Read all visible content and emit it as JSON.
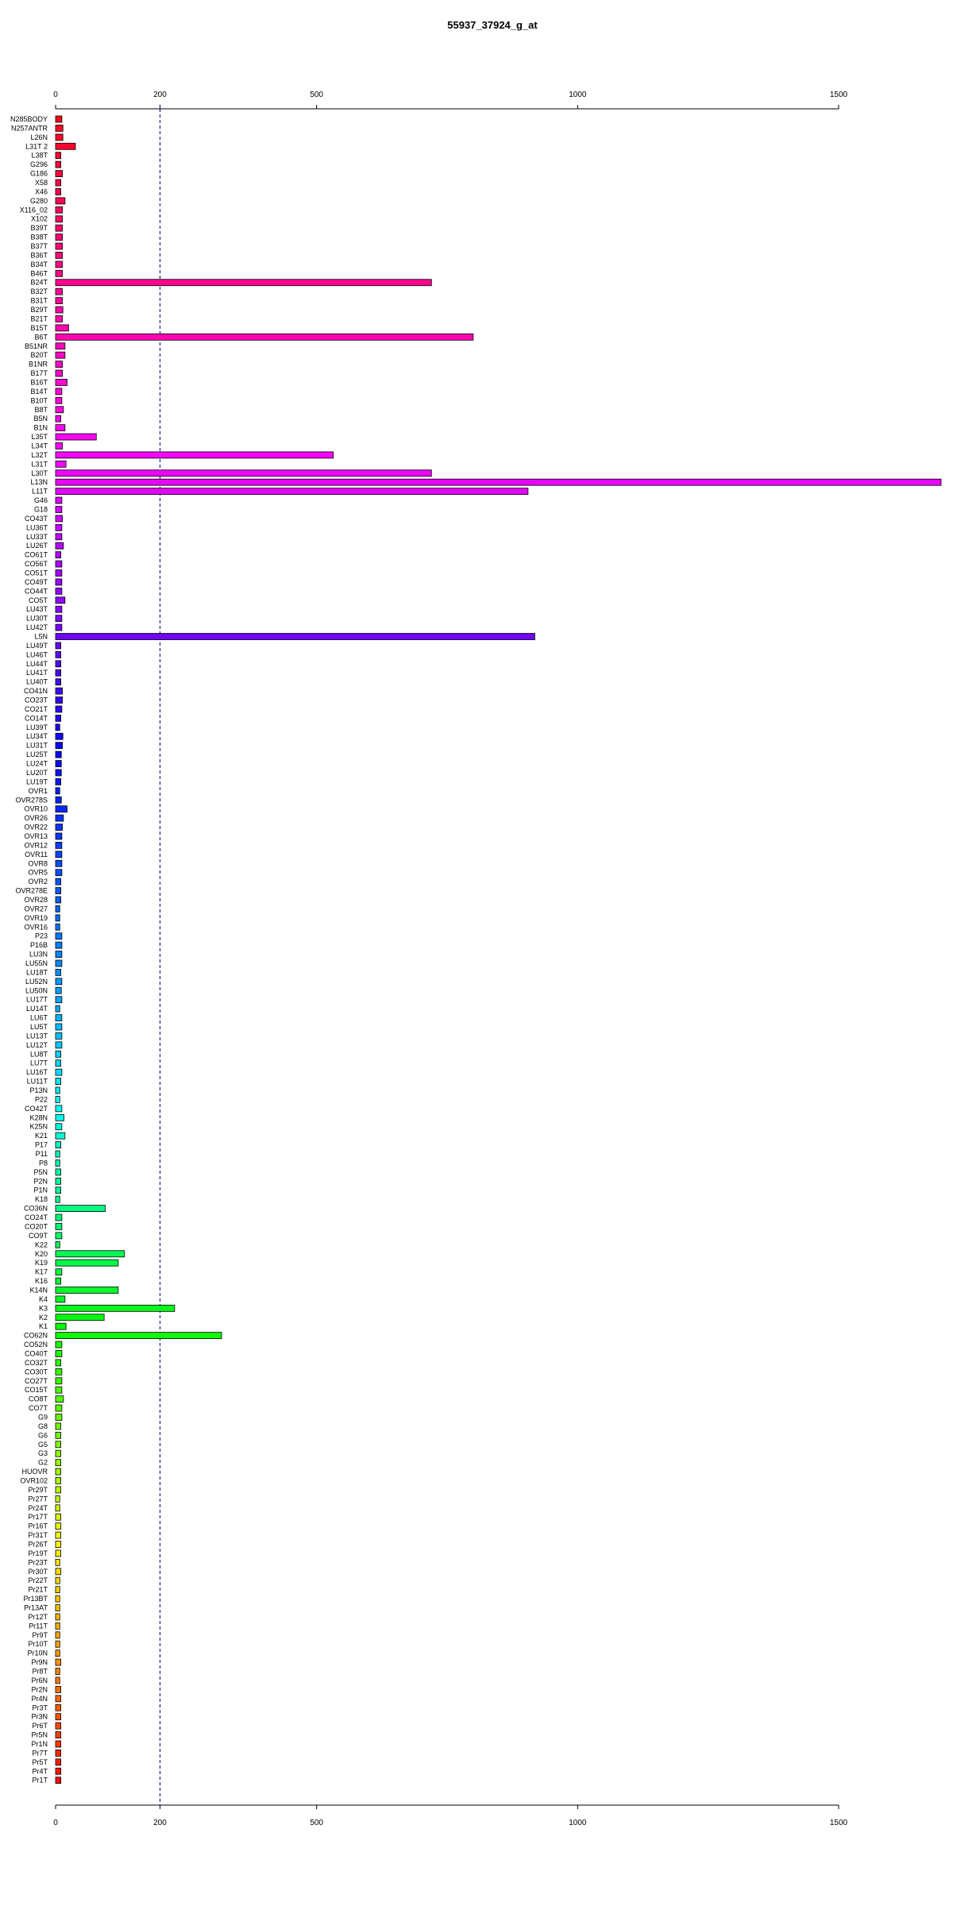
{
  "chart_data": {
    "type": "bar",
    "orientation": "horizontal",
    "title": "55937_37924_g_at",
    "xlabel": "",
    "ylabel": "",
    "xlim": [
      0,
      1500
    ],
    "xticks": [
      0,
      200,
      500,
      1000,
      1500
    ],
    "xtick_labels": [
      "0",
      "200",
      "500",
      "1000",
      "1500"
    ],
    "reference_line": 200,
    "axis_positions": [
      "top",
      "bottom"
    ],
    "bar_outline_color": "#000000",
    "bar_colors": "rainbow gradient from top to bottom: red, magenta, purple, blue, cyan, green, yellow, orange, red",
    "categories": [
      "N285BODY",
      "N257ANTR",
      "L26N",
      "L31T 2",
      "L38T",
      "G296",
      "G186",
      "X58",
      "X46",
      "G280",
      "X116_02",
      "X102",
      "B39T",
      "B38T",
      "B37T",
      "B36T",
      "B34T",
      "B46T",
      "B24T",
      "B32T",
      "B31T",
      "B29T",
      "B21T",
      "B15T",
      "B6T",
      "B51NR",
      "B20T",
      "B1NR",
      "B17T",
      "B16T",
      "B14T",
      "B10T",
      "B8T",
      "B5N",
      "B1N",
      "L35T",
      "L34T",
      "L32T",
      "L31T",
      "L30T",
      "L13N",
      "L11T",
      "G46",
      "G18",
      "CO43T",
      "LU36T",
      "LU33T",
      "LU26T",
      "CO61T",
      "CO56T",
      "CO51T",
      "CO49T",
      "CO44T",
      "CO5T",
      "LU43T",
      "LU30T",
      "LU42T",
      "L5N",
      "LU49T",
      "LU46T",
      "LU44T",
      "LU41T",
      "LU40T",
      "CO41N",
      "CO23T",
      "CO21T",
      "CO14T",
      "LU39T",
      "LU34T",
      "LU31T",
      "LU25T",
      "LU24T",
      "LU20T",
      "LU19T",
      "OVR1",
      "OVR278S",
      "OVR10",
      "OVR26",
      "OVR22",
      "OVR13",
      "OVR12",
      "OVR11",
      "OVR8",
      "OVR5",
      "OVR2",
      "OVR278E",
      "OVR28",
      "OVR27",
      "OVR19",
      "OVR16",
      "P23",
      "P16B",
      "LU3N",
      "LU55N",
      "LU18T",
      "LU52N",
      "LU50N",
      "LU17T",
      "LU14T",
      "LU6T",
      "LU5T",
      "LU13T",
      "LU12T",
      "LU8T",
      "LU7T",
      "LU16T",
      "LU11T",
      "P13N",
      "P22",
      "CO42T",
      "K28N",
      "K25N",
      "K21",
      "P17",
      "P11",
      "P8",
      "P5N",
      "P2N",
      "P1N",
      "K18",
      "CO36N",
      "CO24T",
      "CO20T",
      "CO9T",
      "K22",
      "K20",
      "K19",
      "K17",
      "K16",
      "K14N",
      "K4",
      "K3",
      "K2",
      "K1",
      "CO62N",
      "CO52N",
      "CO40T",
      "CO32T",
      "CO30T",
      "CO27T",
      "CO15T",
      "CO8T",
      "CO7T",
      "G9",
      "G8",
      "G6",
      "G5",
      "G3",
      "G2",
      "HUOVR",
      "OVR102",
      "Pr29T",
      "Pr27T",
      "Pr24T",
      "Pr17T",
      "Pr16T",
      "Pr31T",
      "Pr26T",
      "Pr19T",
      "Pr23T",
      "Pr30T",
      "Pr22T",
      "Pr21T",
      "Pr13BT",
      "Pr13AT",
      "Pr12T",
      "Pr11T",
      "Pr9T",
      "Pr10T",
      "Pr10N",
      "Pr9N",
      "Pr8T",
      "Pr6N",
      "Pr2N",
      "Pr4N",
      "Pr3T",
      "Pr3N",
      "Pr6T",
      "Pr5N",
      "Pr1N",
      "Pr7T",
      "Pr5T",
      "Pr4T",
      "Pr1T"
    ],
    "values": [
      12,
      14,
      14,
      38,
      10,
      10,
      13,
      10,
      10,
      18,
      13,
      13,
      13,
      13,
      13,
      13,
      13,
      13,
      720,
      13,
      13,
      14,
      13,
      25,
      800,
      18,
      18,
      13,
      13,
      22,
      12,
      12,
      15,
      10,
      18,
      78,
      13,
      532,
      20,
      720,
      1692,
      905,
      12,
      12,
      13,
      12,
      12,
      15,
      10,
      12,
      12,
      12,
      12,
      18,
      12,
      12,
      12,
      918,
      10,
      10,
      10,
      10,
      10,
      13,
      13,
      12,
      10,
      8,
      14,
      13,
      11,
      11,
      11,
      10,
      8,
      11,
      22,
      15,
      13,
      12,
      12,
      12,
      12,
      12,
      10,
      10,
      10,
      8,
      8,
      8,
      12,
      12,
      12,
      12,
      10,
      12,
      11,
      12,
      8,
      12,
      12,
      12,
      12,
      10,
      10,
      12,
      10,
      8,
      8,
      12,
      16,
      12,
      18,
      10,
      8,
      8,
      10,
      10,
      10,
      8,
      95,
      12,
      12,
      12,
      8,
      132,
      120,
      12,
      10,
      120,
      18,
      228,
      93,
      20,
      318,
      12,
      12,
      10,
      12,
      12,
      12,
      15,
      12,
      12,
      10,
      10,
      10,
      10,
      10,
      10,
      10,
      10,
      8,
      8,
      10,
      10,
      10,
      10,
      10,
      8,
      10,
      8,
      8,
      8,
      8,
      8,
      8,
      8,
      8,
      8,
      10,
      8,
      8,
      10,
      10,
      10,
      10,
      10,
      10,
      10,
      10,
      10,
      10,
      10,
      10,
      10,
      10,
      8
    ]
  }
}
